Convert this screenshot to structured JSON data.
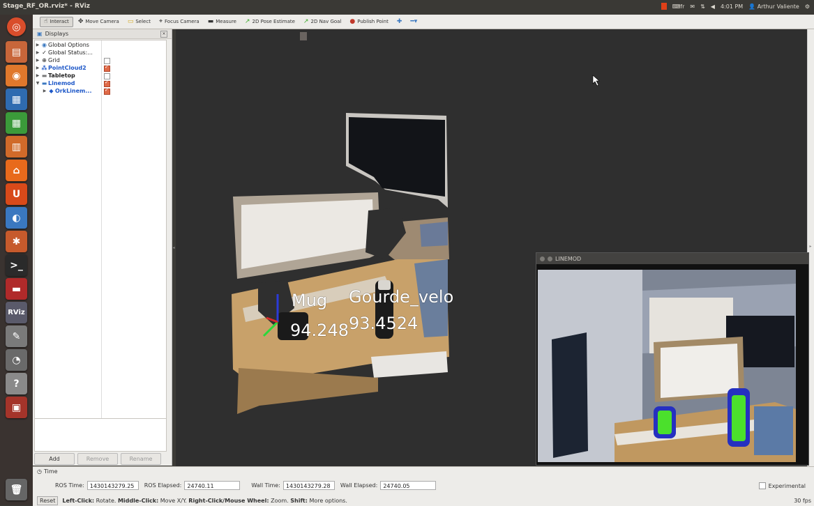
{
  "window": {
    "title": "Stage_RF_OR.rviz* - RViz"
  },
  "tray": {
    "keyboard": "fr",
    "clock": "4:01 PM",
    "user": "Arthur Valiente"
  },
  "toolbar": {
    "interact": "Interact",
    "move_camera": "Move Camera",
    "select": "Select",
    "focus_camera": "Focus Camera",
    "measure": "Measure",
    "pose_estimate": "2D Pose Estimate",
    "nav_goal": "2D Nav Goal",
    "publish_point": "Publish Point"
  },
  "displays": {
    "title": "Displays",
    "items": [
      {
        "label": "Global Options"
      },
      {
        "label": "Global Status:..."
      },
      {
        "label": "Grid"
      },
      {
        "label": "PointCloud2"
      },
      {
        "label": "Tabletop"
      },
      {
        "label": "Linemod"
      },
      {
        "label": "OrkLinem..."
      }
    ],
    "buttons": {
      "add": "Add",
      "remove": "Remove",
      "rename": "Rename"
    }
  },
  "scene": {
    "label_mug": "Mug",
    "label_gourde": "Gourde_velo",
    "score_mug": "94.248",
    "score_gourde": "93.4524"
  },
  "linemod_window": {
    "title": "LINEMOD"
  },
  "time_panel": {
    "title": "Time",
    "ros_time_label": "ROS Time:",
    "ros_time": "1430143279.25",
    "ros_elapsed_label": "ROS Elapsed:",
    "ros_elapsed": "24740.11",
    "wall_time_label": "Wall Time:",
    "wall_time": "1430143279.28",
    "wall_elapsed_label": "Wall Elapsed:",
    "wall_elapsed": "24740.05",
    "experimental": "Experimental"
  },
  "status": {
    "reset": "Reset",
    "left_click": "Left-Click:",
    "left_text": "Rotate.",
    "middle_click": "Middle-Click:",
    "middle_text": "Move X/Y.",
    "right_click": "Right-Click/Mouse Wheel:",
    "right_text": "Zoom.",
    "shift": "Shift:",
    "shift_text": "More options.",
    "fps": "30 fps"
  },
  "colors": {
    "accent": "#1e58c8",
    "checked": "#e06a48",
    "viewport_bg": "#2f2f2f"
  }
}
